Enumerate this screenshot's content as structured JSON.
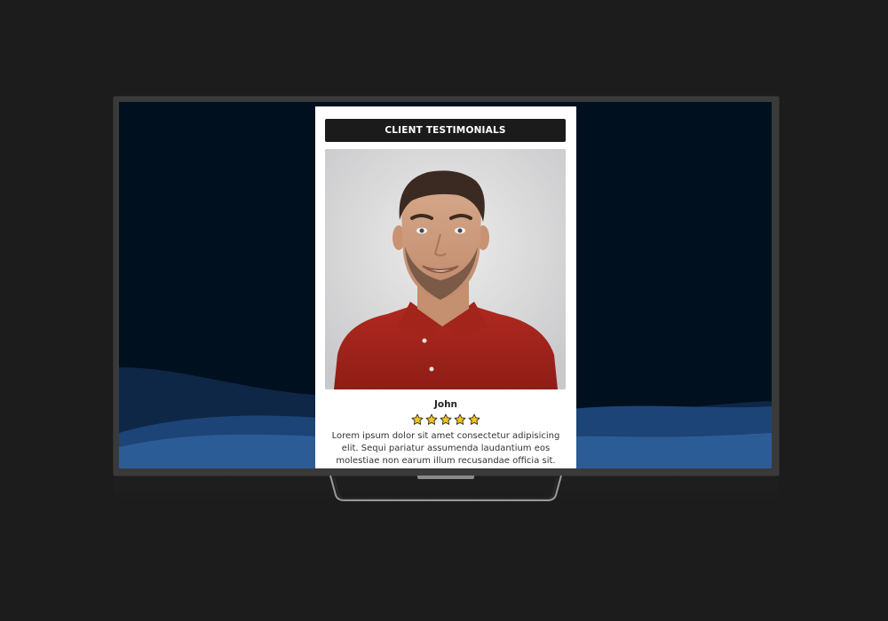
{
  "testimonial": {
    "header": "CLIENT TESTIMONIALS",
    "client_name": "John",
    "rating": 5,
    "rating_max": 5,
    "quote": "Lorem ipsum dolor sit amet consectetur adipisicing elit. Sequi pariatur assumenda laudantium eos molestiae non earum illum recusandae officia sit."
  },
  "colors": {
    "screen_background": "#00101f",
    "wave_dark": "#14305a",
    "wave_light": "#2c5c96",
    "header_background": "#1b1b1b",
    "star_fill": "#f5c518"
  },
  "icons": {
    "star": "star-icon"
  }
}
